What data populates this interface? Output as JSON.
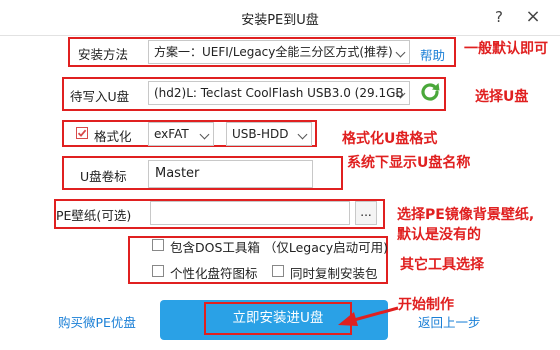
{
  "window": {
    "title": "安装PE到U盘",
    "help": "?",
    "close": "×"
  },
  "install_method": {
    "label": "安装方法",
    "value": "方案一：UEFI/Legacy全能三分区方式(推荐)",
    "help_link": "帮助"
  },
  "target_disk": {
    "label": "待写入U盘",
    "value": "(hd2)L: Teclast CoolFlash USB3.0 (29.1GB"
  },
  "format": {
    "label": "格式化",
    "checked": true,
    "fs_value": "exFAT",
    "mode_value": "USB-HDD"
  },
  "volume_label": {
    "label": "U盘卷标",
    "value": "Master"
  },
  "wallpaper": {
    "label": "PE壁纸(可选)",
    "value": "",
    "browse": "..."
  },
  "options": [
    {
      "label": "包含DOS工具箱 （仅Legacy启动可用)",
      "checked": false
    },
    {
      "label": "个性化盘符图标",
      "checked": false
    },
    {
      "label": "同时复制安装包",
      "checked": false
    }
  ],
  "footer": {
    "buy_link": "购买微PE优盘",
    "install_button": "立即安装进U盘",
    "back_link": "返回上一步"
  },
  "annotations": {
    "default_note": "一般默认即可",
    "select_disk_note": "选择U盘",
    "format_note": "格式化U盘格式",
    "name_note": "系统下显示U盘名称",
    "wallpaper_note_1": "选择PE镜像背景壁纸,",
    "wallpaper_note_2": "默认是没有的",
    "tools_note": "其它工具选择",
    "start_note": "开始制作"
  },
  "colors": {
    "annotation_red": "#e02020",
    "accent_blue": "#2aa1e6",
    "link_blue": "#1a7fd6",
    "refresh_green": "#4aa83a"
  }
}
